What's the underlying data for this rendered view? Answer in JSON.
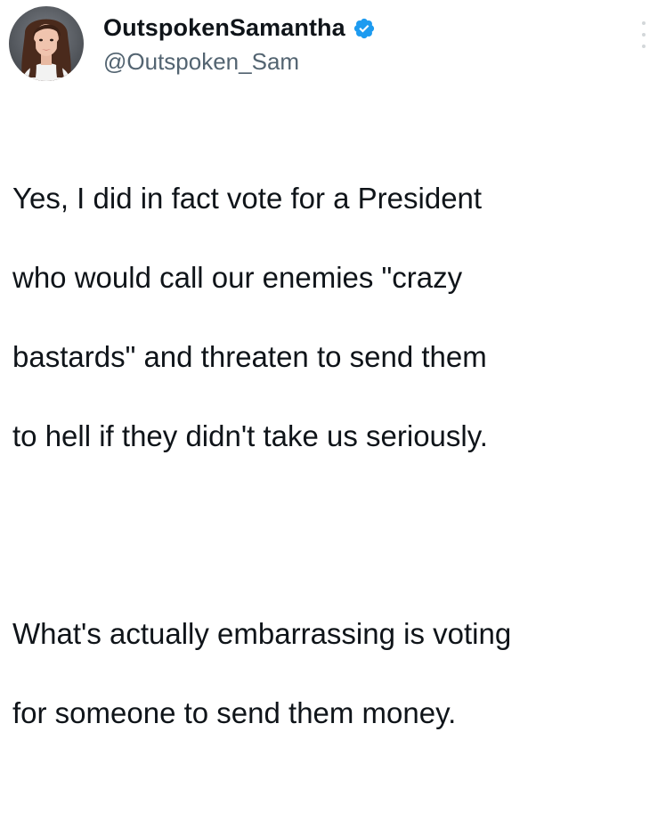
{
  "author": {
    "display_name": "OutspokenSamantha",
    "handle": "@Outspoken_Sam",
    "verified": true,
    "avatar_icon": "profile-photo"
  },
  "tweet": {
    "paragraph_1_lines": [
      "Yes, I did in fact vote for a President",
      "who would call our enemies \"crazy",
      "bastards\" and threaten to send them",
      "to hell if they didn't take us seriously."
    ],
    "paragraph_2_lines": [
      "What's actually embarrassing is voting",
      "for someone to send them money."
    ]
  },
  "colors": {
    "name": "#0f1419",
    "handle": "#536471",
    "verified": "#1d9bf0",
    "background": "#ffffff"
  },
  "icons": {
    "verified": "verified-badge-icon",
    "more": "more-options-icon"
  }
}
